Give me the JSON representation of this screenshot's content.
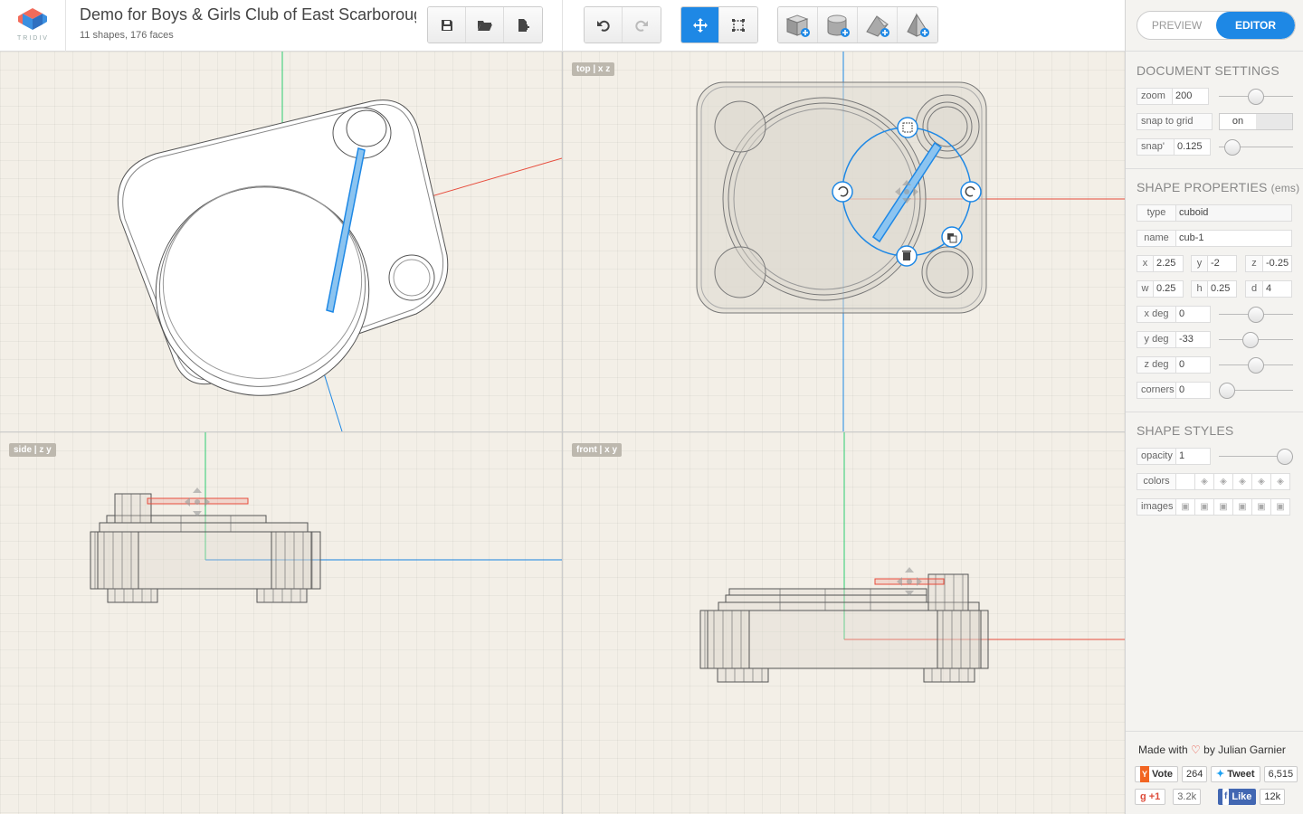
{
  "app": {
    "brand": "TRIDIV"
  },
  "document": {
    "title": "Demo for Boys & Girls Club of East Scarborough",
    "subtitle": "11 shapes, 176 faces"
  },
  "toolbar": {
    "file": [
      "save-icon",
      "open-folder-icon",
      "new-file-icon"
    ],
    "history": [
      "undo-icon",
      "redo-icon"
    ],
    "tools": [
      "move-icon",
      "select-icon"
    ],
    "shapes": [
      "add-cube-icon",
      "add-cylinder-icon",
      "add-prism-icon",
      "add-pyramid-icon"
    ]
  },
  "viewports": {
    "top": {
      "tag": "top | x z"
    },
    "side": {
      "tag": "side | z y"
    },
    "front": {
      "tag": "front | x y"
    }
  },
  "mode": {
    "preview": "PREVIEW",
    "editor": "EDITOR",
    "active": "editor"
  },
  "document_settings": {
    "title": "DOCUMENT SETTINGS",
    "zoom_label": "zoom",
    "zoom_value": "200",
    "zoom_level": 0.5,
    "snap_grid_label": "snap to grid",
    "snap_grid_value": "on",
    "snap_label": "snap'",
    "snap_value": "0.125",
    "snap_level": 0.1
  },
  "shape_properties": {
    "title": "SHAPE PROPERTIES",
    "units": "(ems)",
    "type_label": "type",
    "type_value": "cuboid",
    "name_label": "name",
    "name_value": "cub-1",
    "x_label": "x",
    "x_value": "2.25",
    "y_label": "y",
    "y_value": "-2",
    "z_label": "z",
    "z_value": "-0.25",
    "w_label": "w",
    "w_value": "0.25",
    "h_label": "h",
    "h_value": "0.25",
    "d_label": "d",
    "d_value": "4",
    "xdeg_label": "x deg",
    "xdeg_value": "0",
    "xdeg_level": 0.5,
    "ydeg_label": "y deg",
    "ydeg_value": "-33",
    "ydeg_level": 0.41,
    "zdeg_label": "z deg",
    "zdeg_value": "0",
    "zdeg_level": 0.5,
    "corners_label": "corners",
    "corners_value": "0",
    "corners_level": 0.0
  },
  "shape_styles": {
    "title": "SHAPE STYLES",
    "opacity_label": "opacity",
    "opacity_value": "1",
    "opacity_level": 1.0,
    "colors_label": "colors",
    "images_label": "images"
  },
  "credits": {
    "made_with": "Made with",
    "by": "by Julian Garnier",
    "vote_label": "Vote",
    "vote_count": "264",
    "tweet_label": "Tweet",
    "tweet_count": "6,515",
    "gplus_label": "+1",
    "gplus_count": "3.2k",
    "like_label": "Like",
    "like_count": "12k"
  },
  "colors": {
    "accent": "#1e88e5",
    "axis_x": "#e74c3c",
    "axis_y": "#2ecc71",
    "axis_z": "#1e88e5"
  }
}
